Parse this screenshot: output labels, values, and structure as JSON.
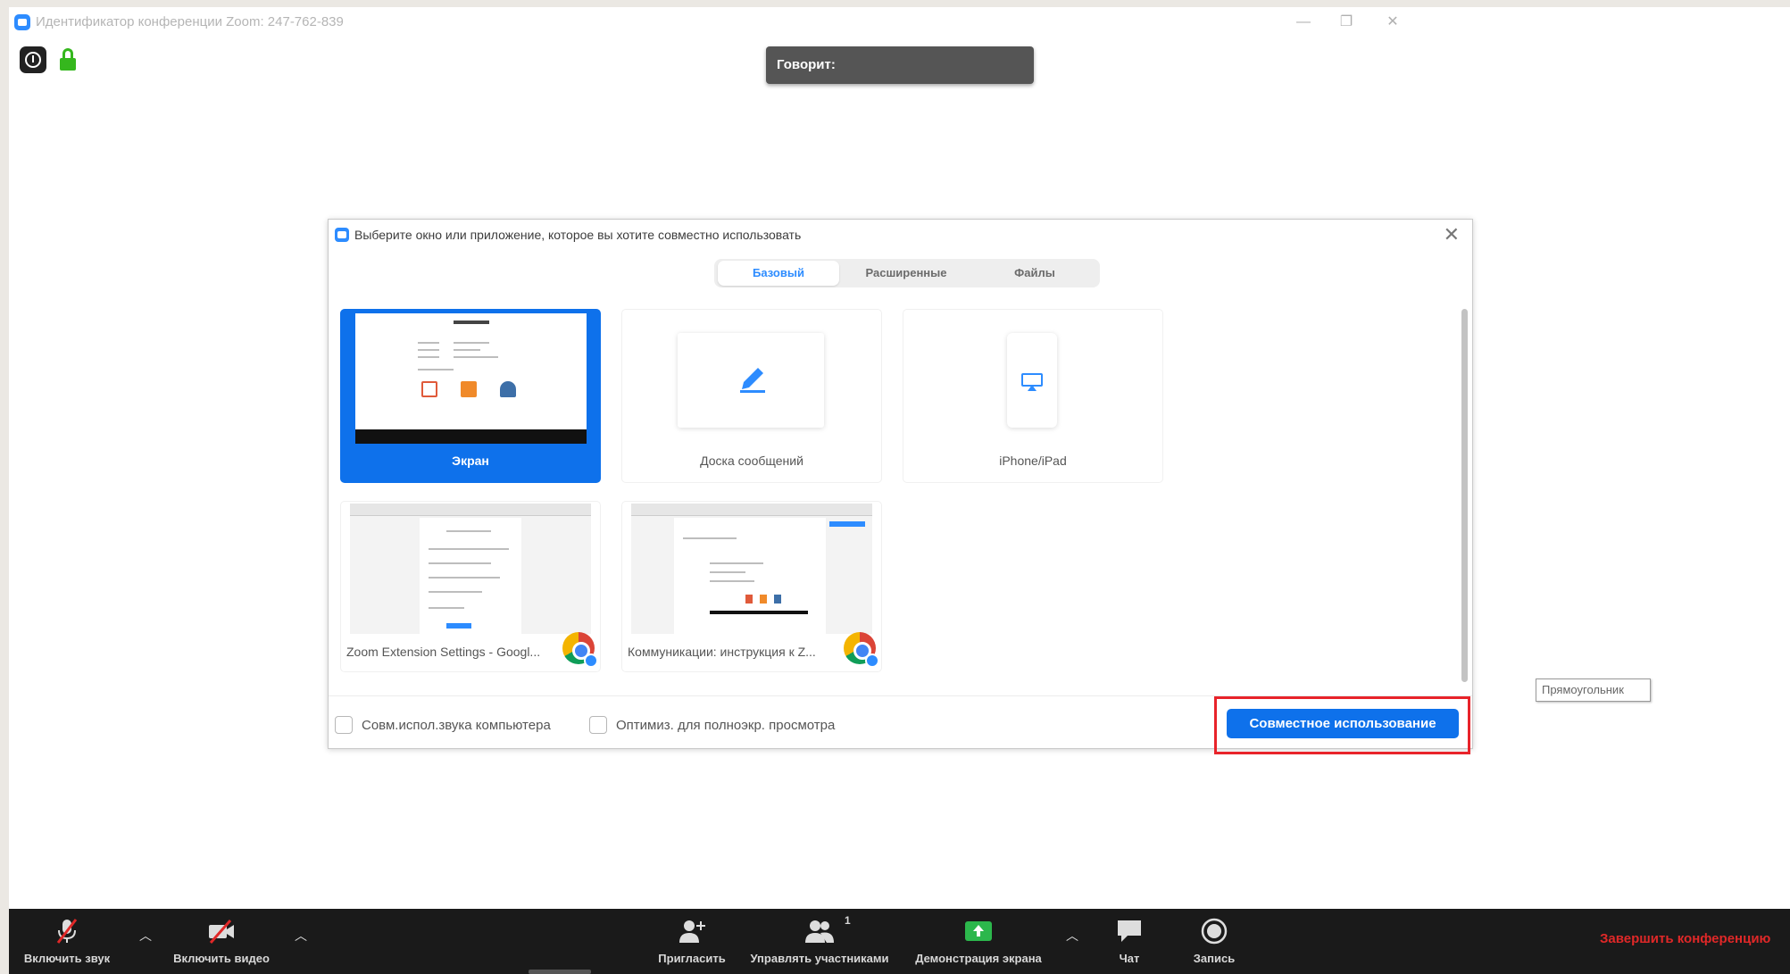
{
  "window": {
    "title": "Идентификатор конференции Zoom: 247-762-839",
    "minimize": "—",
    "restore": "❐",
    "close": "✕"
  },
  "speaker": {
    "label": "Говорит:"
  },
  "dialog": {
    "title": "Выберите окно или приложение, которое вы хотите совместно использовать",
    "close": "✕",
    "tabs": [
      {
        "label": "Базовый",
        "active": true
      },
      {
        "label": "Расширенные",
        "active": false
      },
      {
        "label": "Файлы",
        "active": false
      }
    ],
    "tiles": [
      {
        "label": "Экран",
        "selected": true
      },
      {
        "label": "Доска сообщений",
        "selected": false
      },
      {
        "label": "iPhone/iPad",
        "selected": false
      }
    ],
    "windows": [
      {
        "label": "Zoom Extension Settings - Googl..."
      },
      {
        "label": "Коммуникации: инструкция к Z..."
      }
    ],
    "options": [
      {
        "label": "Совм.испол.звука компьютера",
        "checked": false
      },
      {
        "label": "Оптимиз. для полноэкр. просмотра",
        "checked": false
      }
    ],
    "share_button": "Совместное использование"
  },
  "tooltip": {
    "label": "Прямоугольник"
  },
  "toolbar": {
    "unmute": "Включить звук",
    "start_video": "Включить видео",
    "invite": "Пригласить",
    "participants": "Управлять участниками",
    "participants_count": "1",
    "share_screen": "Демонстрация экрана",
    "chat": "Чат",
    "record": "Запись",
    "end": "Завершить конференцию"
  },
  "colors": {
    "accent": "#0e71eb",
    "highlight": "#e8232a",
    "end_red": "#e02828",
    "share_green": "#2cb74c"
  }
}
